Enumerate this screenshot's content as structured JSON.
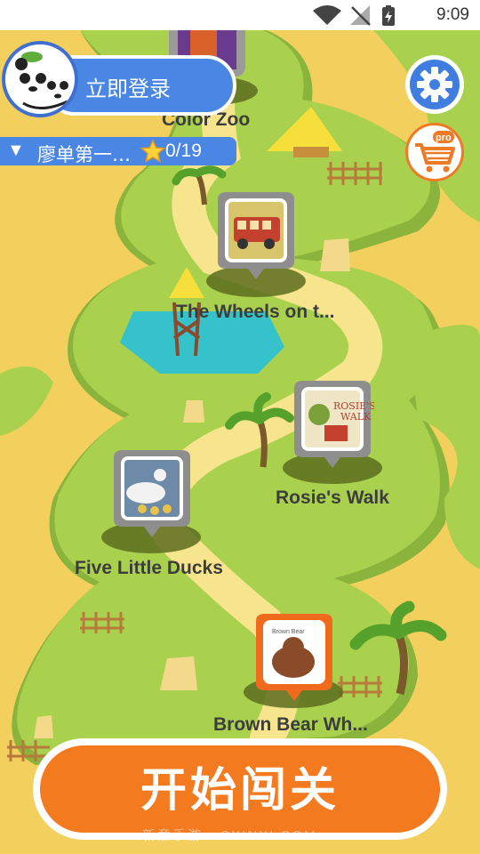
{
  "status_bar": {
    "time": "9:09"
  },
  "user": {
    "login_label": "立即登录"
  },
  "progress": {
    "arrow": "▼",
    "name": "廖单第一…",
    "count": "0/19"
  },
  "levels": [
    {
      "label": "Color Zoo"
    },
    {
      "label": "The Wheels on t..."
    },
    {
      "label": "Rosie's Walk"
    },
    {
      "label": "Five Little Ducks"
    },
    {
      "label": "Brown Bear Wh..."
    }
  ],
  "start_button": {
    "label": "开始闯关"
  },
  "watermark": "新意手游 · CXINXI.COM",
  "icons": {
    "settings": "gear-icon",
    "cart": "shopping-cart-pro-icon",
    "star": "star-icon",
    "avatar": "panda-avatar"
  },
  "colors": {
    "map_background": "#f3cf5e",
    "grass": "#a9d14e",
    "path": "#f7e58e",
    "accent_blue": "#4a86e4",
    "accent_orange": "#f47a20"
  }
}
